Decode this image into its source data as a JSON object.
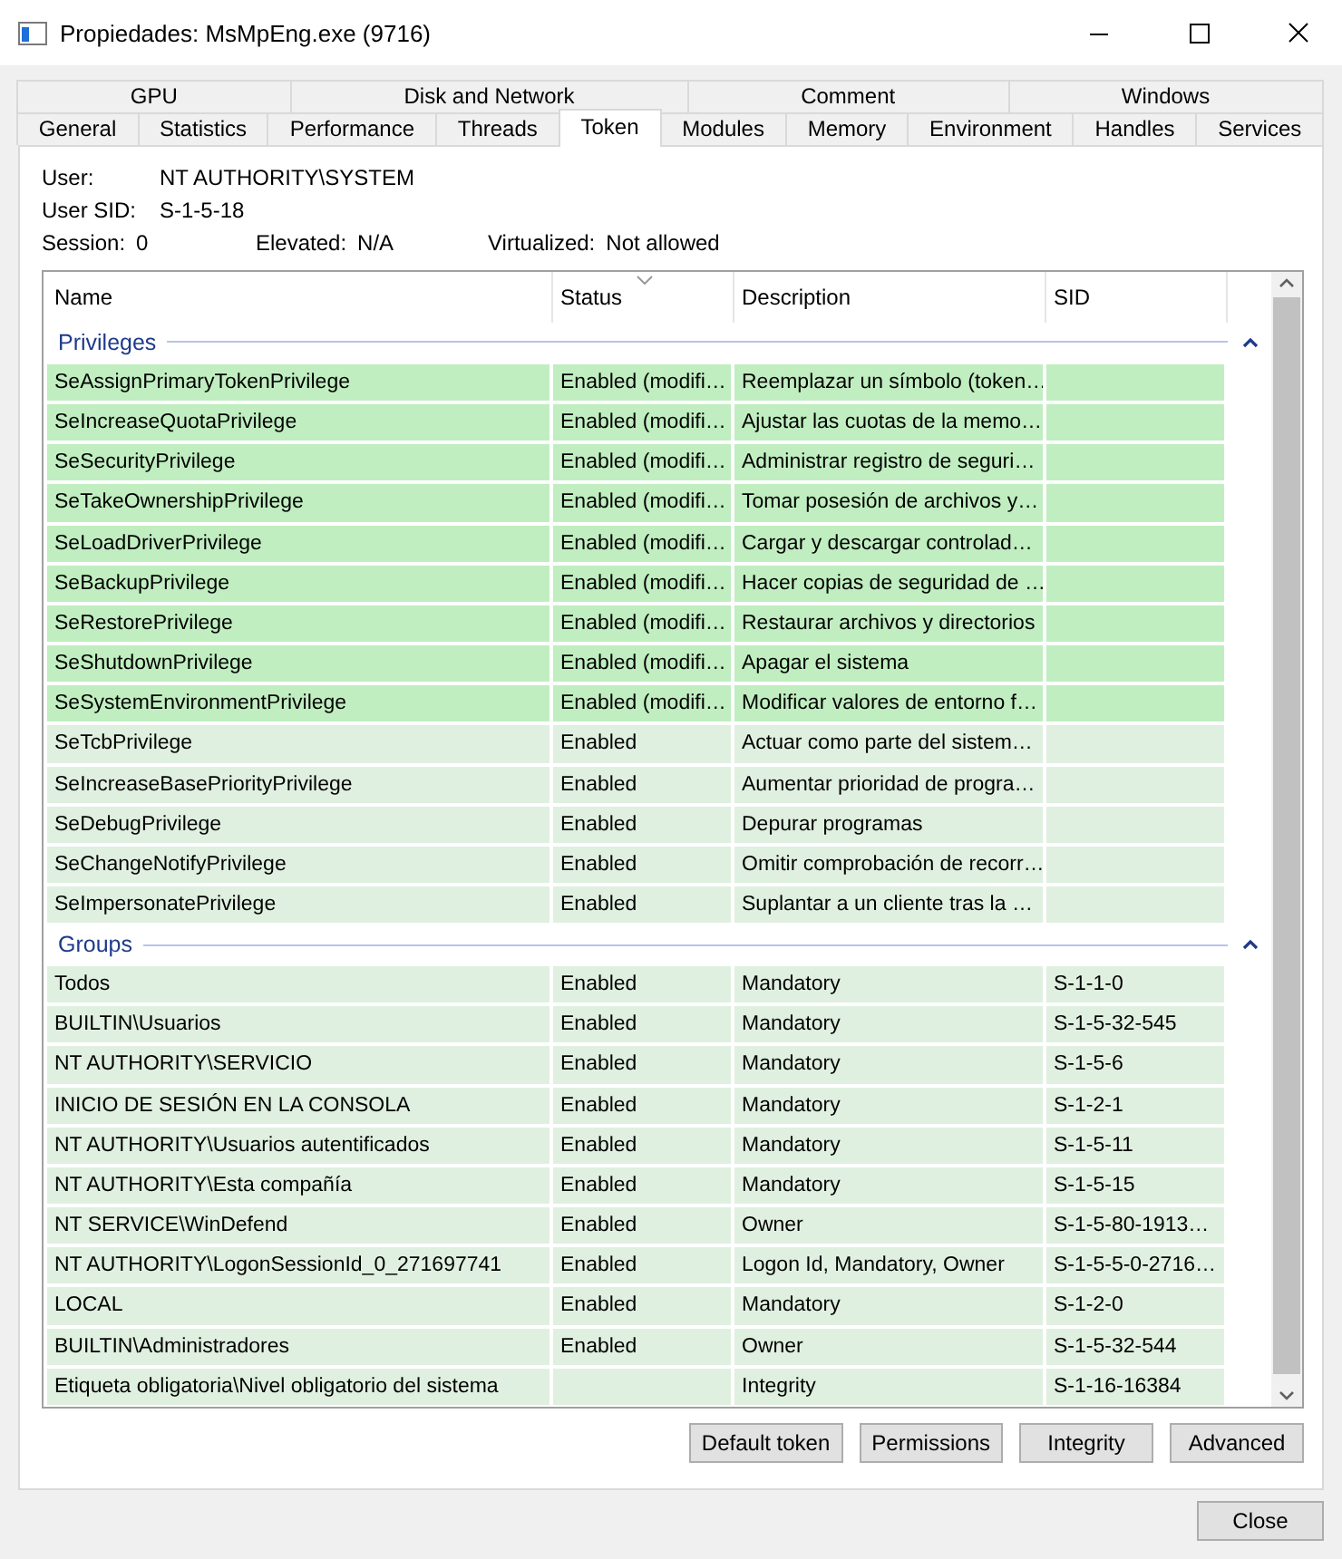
{
  "window": {
    "title": "Propiedades: MsMpEng.exe (9716)"
  },
  "tab_rows": [
    [
      {
        "label": "GPU",
        "selected": false
      },
      {
        "label": "Disk and Network",
        "selected": false
      },
      {
        "label": "Comment",
        "selected": false
      },
      {
        "label": "Windows",
        "selected": false
      }
    ],
    [
      {
        "label": "General",
        "selected": false
      },
      {
        "label": "Statistics",
        "selected": false
      },
      {
        "label": "Performance",
        "selected": false
      },
      {
        "label": "Threads",
        "selected": false
      },
      {
        "label": "Token",
        "selected": true
      },
      {
        "label": "Modules",
        "selected": false
      },
      {
        "label": "Memory",
        "selected": false
      },
      {
        "label": "Environment",
        "selected": false
      },
      {
        "label": "Handles",
        "selected": false
      },
      {
        "label": "Services",
        "selected": false
      }
    ]
  ],
  "info_lines": [
    [
      {
        "label": "User:",
        "value": "NT AUTHORITY\\SYSTEM"
      }
    ],
    [
      {
        "label": "User SID:",
        "value": "S-1-5-18"
      }
    ],
    [
      {
        "label": "Session:",
        "value": "0"
      },
      {
        "label": "Elevated:",
        "value": "N/A"
      },
      {
        "label": "Virtualized:",
        "value": "Not allowed"
      }
    ]
  ],
  "table": {
    "columns": [
      "Name",
      "Status",
      "Description",
      "SID"
    ],
    "groups": [
      {
        "title": "Privileges",
        "expanded": true,
        "rows": [
          {
            "cells": [
              "SeAssignPrimaryTokenPrivilege",
              "Enabled (modifi…",
              "Reemplazar un símbolo (token…",
              ""
            ],
            "color": "#c0eec0"
          },
          {
            "cells": [
              "SeIncreaseQuotaPrivilege",
              "Enabled (modifi…",
              "Ajustar las cuotas de la memo…",
              ""
            ],
            "color": "#c0eec0"
          },
          {
            "cells": [
              "SeSecurityPrivilege",
              "Enabled (modifi…",
              "Administrar registro de seguri…",
              ""
            ],
            "color": "#c0eec0"
          },
          {
            "cells": [
              "SeTakeOwnershipPrivilege",
              "Enabled (modifi…",
              "Tomar posesión de archivos y…",
              ""
            ],
            "color": "#c0eec0"
          },
          {
            "cells": [
              "SeLoadDriverPrivilege",
              "Enabled (modifi…",
              "Cargar y descargar controlad…",
              ""
            ],
            "color": "#c0eec0"
          },
          {
            "cells": [
              "SeBackupPrivilege",
              "Enabled (modifi…",
              "Hacer copias de seguridad de …",
              ""
            ],
            "color": "#c0eec0"
          },
          {
            "cells": [
              "SeRestorePrivilege",
              "Enabled (modifi…",
              "Restaurar archivos y directorios",
              ""
            ],
            "color": "#c0eec0"
          },
          {
            "cells": [
              "SeShutdownPrivilege",
              "Enabled (modifi…",
              "Apagar el sistema",
              ""
            ],
            "color": "#c0eec0"
          },
          {
            "cells": [
              "SeSystemEnvironmentPrivilege",
              "Enabled (modifi…",
              "Modificar valores de entorno f…",
              ""
            ],
            "color": "#c0eec0"
          },
          {
            "cells": [
              "SeTcbPrivilege",
              "Enabled",
              "Actuar como parte del sistem…",
              ""
            ],
            "color": "#e0f0e0"
          },
          {
            "cells": [
              "SeIncreaseBasePriorityPrivilege",
              "Enabled",
              "Aumentar prioridad de progra…",
              ""
            ],
            "color": "#e0f0e0"
          },
          {
            "cells": [
              "SeDebugPrivilege",
              "Enabled",
              "Depurar programas",
              ""
            ],
            "color": "#e0f0e0"
          },
          {
            "cells": [
              "SeChangeNotifyPrivilege",
              "Enabled",
              "Omitir comprobación de recorr…",
              ""
            ],
            "color": "#e0f0e0"
          },
          {
            "cells": [
              "SeImpersonatePrivilege",
              "Enabled",
              "Suplantar a un cliente tras la …",
              ""
            ],
            "color": "#e0f0e0"
          }
        ]
      },
      {
        "title": "Groups",
        "expanded": true,
        "rows": [
          {
            "cells": [
              "Todos",
              "Enabled",
              "Mandatory",
              "S-1-1-0"
            ],
            "color": "#e0f0e0"
          },
          {
            "cells": [
              "BUILTIN\\Usuarios",
              "Enabled",
              "Mandatory",
              "S-1-5-32-545"
            ],
            "color": "#e0f0e0"
          },
          {
            "cells": [
              "NT AUTHORITY\\SERVICIO",
              "Enabled",
              "Mandatory",
              "S-1-5-6"
            ],
            "color": "#e0f0e0"
          },
          {
            "cells": [
              "INICIO DE SESIÓN EN LA CONSOLA",
              "Enabled",
              "Mandatory",
              "S-1-2-1"
            ],
            "color": "#e0f0e0"
          },
          {
            "cells": [
              "NT AUTHORITY\\Usuarios autentificados",
              "Enabled",
              "Mandatory",
              "S-1-5-11"
            ],
            "color": "#e0f0e0"
          },
          {
            "cells": [
              "NT AUTHORITY\\Esta compañía",
              "Enabled",
              "Mandatory",
              "S-1-5-15"
            ],
            "color": "#e0f0e0"
          },
          {
            "cells": [
              "NT SERVICE\\WinDefend",
              "Enabled",
              "Owner",
              "S-1-5-80-1913…"
            ],
            "color": "#e0f0e0"
          },
          {
            "cells": [
              "NT AUTHORITY\\LogonSessionId_0_271697741",
              "Enabled",
              "Logon Id, Mandatory, Owner",
              "S-1-5-5-0-2716…"
            ],
            "color": "#e0f0e0"
          },
          {
            "cells": [
              "LOCAL",
              "Enabled",
              "Mandatory",
              "S-1-2-0"
            ],
            "color": "#e0f0e0"
          },
          {
            "cells": [
              "BUILTIN\\Administradores",
              "Enabled",
              "Owner",
              "S-1-5-32-544"
            ],
            "color": "#e0f0e0"
          },
          {
            "cells": [
              "Etiqueta obligatoria\\Nivel obligatorio del sistema",
              "",
              "Integrity",
              "S-1-16-16384"
            ],
            "color": "#e0f0e0"
          }
        ]
      }
    ]
  },
  "buttons": [
    "Default token",
    "Permissions",
    "Integrity",
    "Advanced"
  ],
  "close_button": "Close"
}
